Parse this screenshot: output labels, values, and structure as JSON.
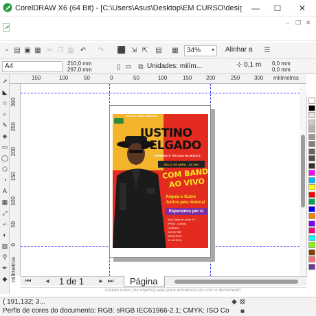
{
  "window": {
    "title": "CorelDRAW X6 (64 Bit) - [C:\\Users\\Asus\\Desktop\\EM CURSO\\design de ...",
    "minimize": "—",
    "maximize": "☐",
    "close": "✕",
    "mdi_minimize": "–",
    "mdi_restore": "❐",
    "mdi_close": "✕"
  },
  "standard_toolbar": {
    "zoom_value": "34%",
    "snap_label": "Alinhar a"
  },
  "property_bar": {
    "page_size": "A4",
    "width": "210,0 mm",
    "height": "297,0 mm",
    "units_label": "Unidades: milím...",
    "nudge": "0,1 m",
    "dup_x": "0,0 mm",
    "dup_y": "0,0 mm"
  },
  "rulers": {
    "h_ticks": [
      "150",
      "100",
      "50",
      "0",
      "50",
      "100",
      "150",
      "200",
      "250",
      "300"
    ],
    "h_unit": "milímetros",
    "v_ticks": [
      "300",
      "250",
      "200",
      "150",
      "100",
      "50",
      "0"
    ],
    "v_unit": "milímetros"
  },
  "poster": {
    "top_line": "MARIOTE KOMBIS ANIMADORA",
    "title_line1": "JUSTINO",
    "title_line2": "DELGADO",
    "tag": "APRESENTA \"ESCUDA NA MÚSICA\"",
    "date": "DIA 12 DE ABRIL - ÀS 20H",
    "band_line1": "COM BANDA",
    "band_line2": "AO VIVO",
    "line1": "Angola e Guiné",
    "line2": "Juntos pela música!",
    "expect": "Esperamos por si",
    "info": [
      "Rua Cidade de Junho nº 7",
      "(Pinhal - Luanda)",
      "Contactos:",
      "923 947 855",
      "933 55 50 59",
      "94 442 55 00"
    ]
  },
  "page_nav": {
    "count": "1 de 1",
    "tab": "Página 1"
  },
  "color_hint": "Arraste cores (ou objetos) aqui para armazená-las com o documento",
  "status": {
    "coords": "( 191,132; 3...",
    "profile": "Perfis de cores do documento: RGB: sRGB IEC61966-2.1; CMYK: ISO Coated v2 (..."
  },
  "palette": [
    "#ffffff",
    "#000000",
    "#e6e6e6",
    "#cccccc",
    "#b3b3b3",
    "#999999",
    "#808080",
    "#666666",
    "#4d4d4d",
    "#333333",
    "#ff00ff",
    "#00b4ff",
    "#ffff00",
    "#ff0000",
    "#00a651",
    "#0000ff",
    "#ff8000",
    "#8000ff",
    "#ff0080",
    "#00ffff",
    "#80ff00",
    "#804000",
    "#ff6f6f",
    "#6a3d9a"
  ]
}
